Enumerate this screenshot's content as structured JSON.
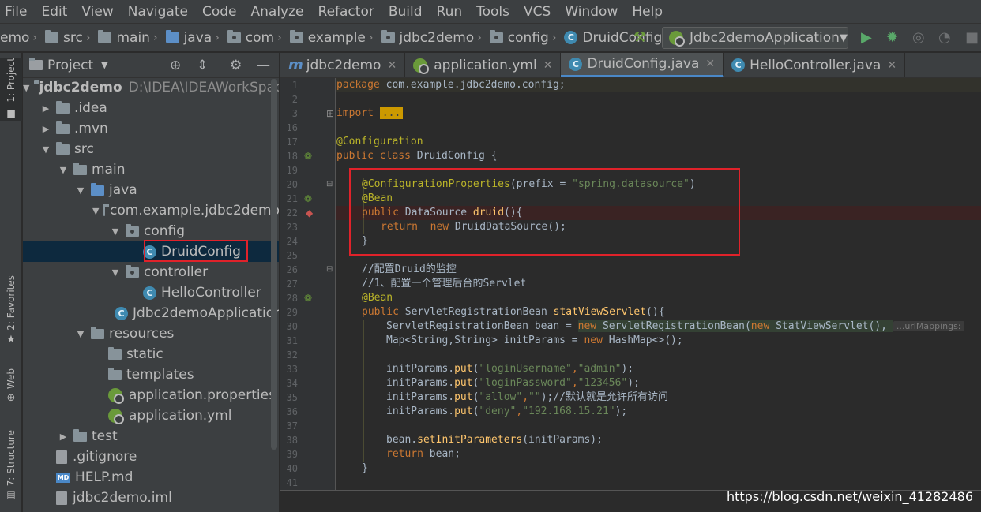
{
  "menu": [
    "File",
    "Edit",
    "View",
    "Navigate",
    "Code",
    "Analyze",
    "Refactor",
    "Build",
    "Run",
    "Tools",
    "VCS",
    "Window",
    "Help"
  ],
  "breadcrumb": [
    "emo",
    "src",
    "main",
    "java",
    "com",
    "example",
    "jdbc2demo",
    "config",
    "DruidConfig"
  ],
  "run_config": "Jdbc2demoApplication",
  "left_strip": {
    "project": "1: Project",
    "favorites": "2: Favorites",
    "web": "Web",
    "structure": "7: Structure"
  },
  "project_panel": {
    "title": "Project",
    "tree": [
      {
        "label": "jdbc2demo",
        "extra": "D:\\IDEA\\IDEAWorkSpace"
      },
      {
        "label": ".idea"
      },
      {
        "label": ".mvn"
      },
      {
        "label": "src"
      },
      {
        "label": "main"
      },
      {
        "label": "java"
      },
      {
        "label": "com.example.jdbc2demo"
      },
      {
        "label": "config"
      },
      {
        "label": "DruidConfig"
      },
      {
        "label": "controller"
      },
      {
        "label": "HelloController"
      },
      {
        "label": "Jdbc2demoApplication"
      },
      {
        "label": "resources"
      },
      {
        "label": "static"
      },
      {
        "label": "templates"
      },
      {
        "label": "application.properties"
      },
      {
        "label": "application.yml"
      },
      {
        "label": "test"
      },
      {
        "label": ".gitignore"
      },
      {
        "label": "HELP.md"
      },
      {
        "label": "jdbc2demo.iml"
      }
    ]
  },
  "tabs": [
    "jdbc2demo",
    "application.yml",
    "DruidConfig.java",
    "HelloController.java"
  ],
  "active_tab": "DruidConfig.java",
  "line_numbers": [
    "1",
    "2",
    "3",
    "16",
    "17",
    "18",
    "19",
    "20",
    "21",
    "22",
    "23",
    "24",
    "25",
    "26",
    "27",
    "28",
    "29",
    "30",
    "31",
    "32",
    "33",
    "34",
    "35",
    "36",
    "37",
    "38",
    "39",
    "40",
    "41"
  ],
  "code": {
    "l1_kw": "package",
    "l1_rest": " com.example.jdbc2demo.config;",
    "l3_kw": "import",
    "l3_fold": "...",
    "l17": "@Configuration",
    "l18_kw": "public class",
    "l18_rest": " DruidConfig {",
    "l20_an": "@ConfigurationProperties",
    "l20_a": "(prefix = ",
    "l20_str": "\"spring.datasource\"",
    "l20_b": ")",
    "l21": "@Bean",
    "l22_kw": "public",
    "l22_a": " DataSource ",
    "l22_fn": "druid",
    "l22_b": "(){",
    "l23_kw1": "return",
    "l23_kw2": "new",
    "l23_rest": " DruidDataSource();",
    "l24": "}",
    "l26": "//配置Druid的监控",
    "l27": "//1、配置一个管理后台的Servlet",
    "l28": "@Bean",
    "l29_kw": "public",
    "l29_a": " ServletRegistrationBean ",
    "l29_fn": "statViewServlet",
    "l29_b": "(){",
    "l30_a": "ServletRegistrationBean bean = ",
    "l30_new1": "new",
    "l30_b": " ServletRegistrationBean(",
    "l30_new2": "new",
    "l30_c": " StatViewServlet(), ",
    "l30_hint": "...urlMappings:",
    "l31": "Map<String,String> initParams = ",
    "l31_kw": "new",
    "l31_b": " HashMap<>();",
    "l33_a": "initParams.",
    "l33_fn": "put",
    "l33_b": "(",
    "l33_s1": "\"loginUsername\"",
    "l33_c": ",",
    "l33_s2": "\"admin\"",
    "l33_d": ");",
    "l34_a": "initParams.",
    "l34_fn": "put",
    "l34_b": "(",
    "l34_s1": "\"loginPassword\"",
    "l34_c": ",",
    "l34_s2": "\"123456\"",
    "l34_d": ");",
    "l35_a": "initParams.",
    "l35_fn": "put",
    "l35_b": "(",
    "l35_s1": "\"allow\"",
    "l35_c": ",",
    "l35_s2": "\"\"",
    "l35_d": ");//默认就是允许所有访问",
    "l36_a": "initParams.",
    "l36_fn": "put",
    "l36_b": "(",
    "l36_s1": "\"deny\"",
    "l36_c": ",",
    "l36_s2": "\"192.168.15.21\"",
    "l36_d": ");",
    "l38_a": "bean.",
    "l38_fn": "setInitParameters",
    "l38_b": "(initParams);",
    "l39_kw": "return",
    "l39_rest": " bean;",
    "l40": "}"
  },
  "watermark": "https://blog.csdn.net/weixin_41282486",
  "colors": {
    "highlight": "#e0222a",
    "accent": "#4a88c7"
  }
}
